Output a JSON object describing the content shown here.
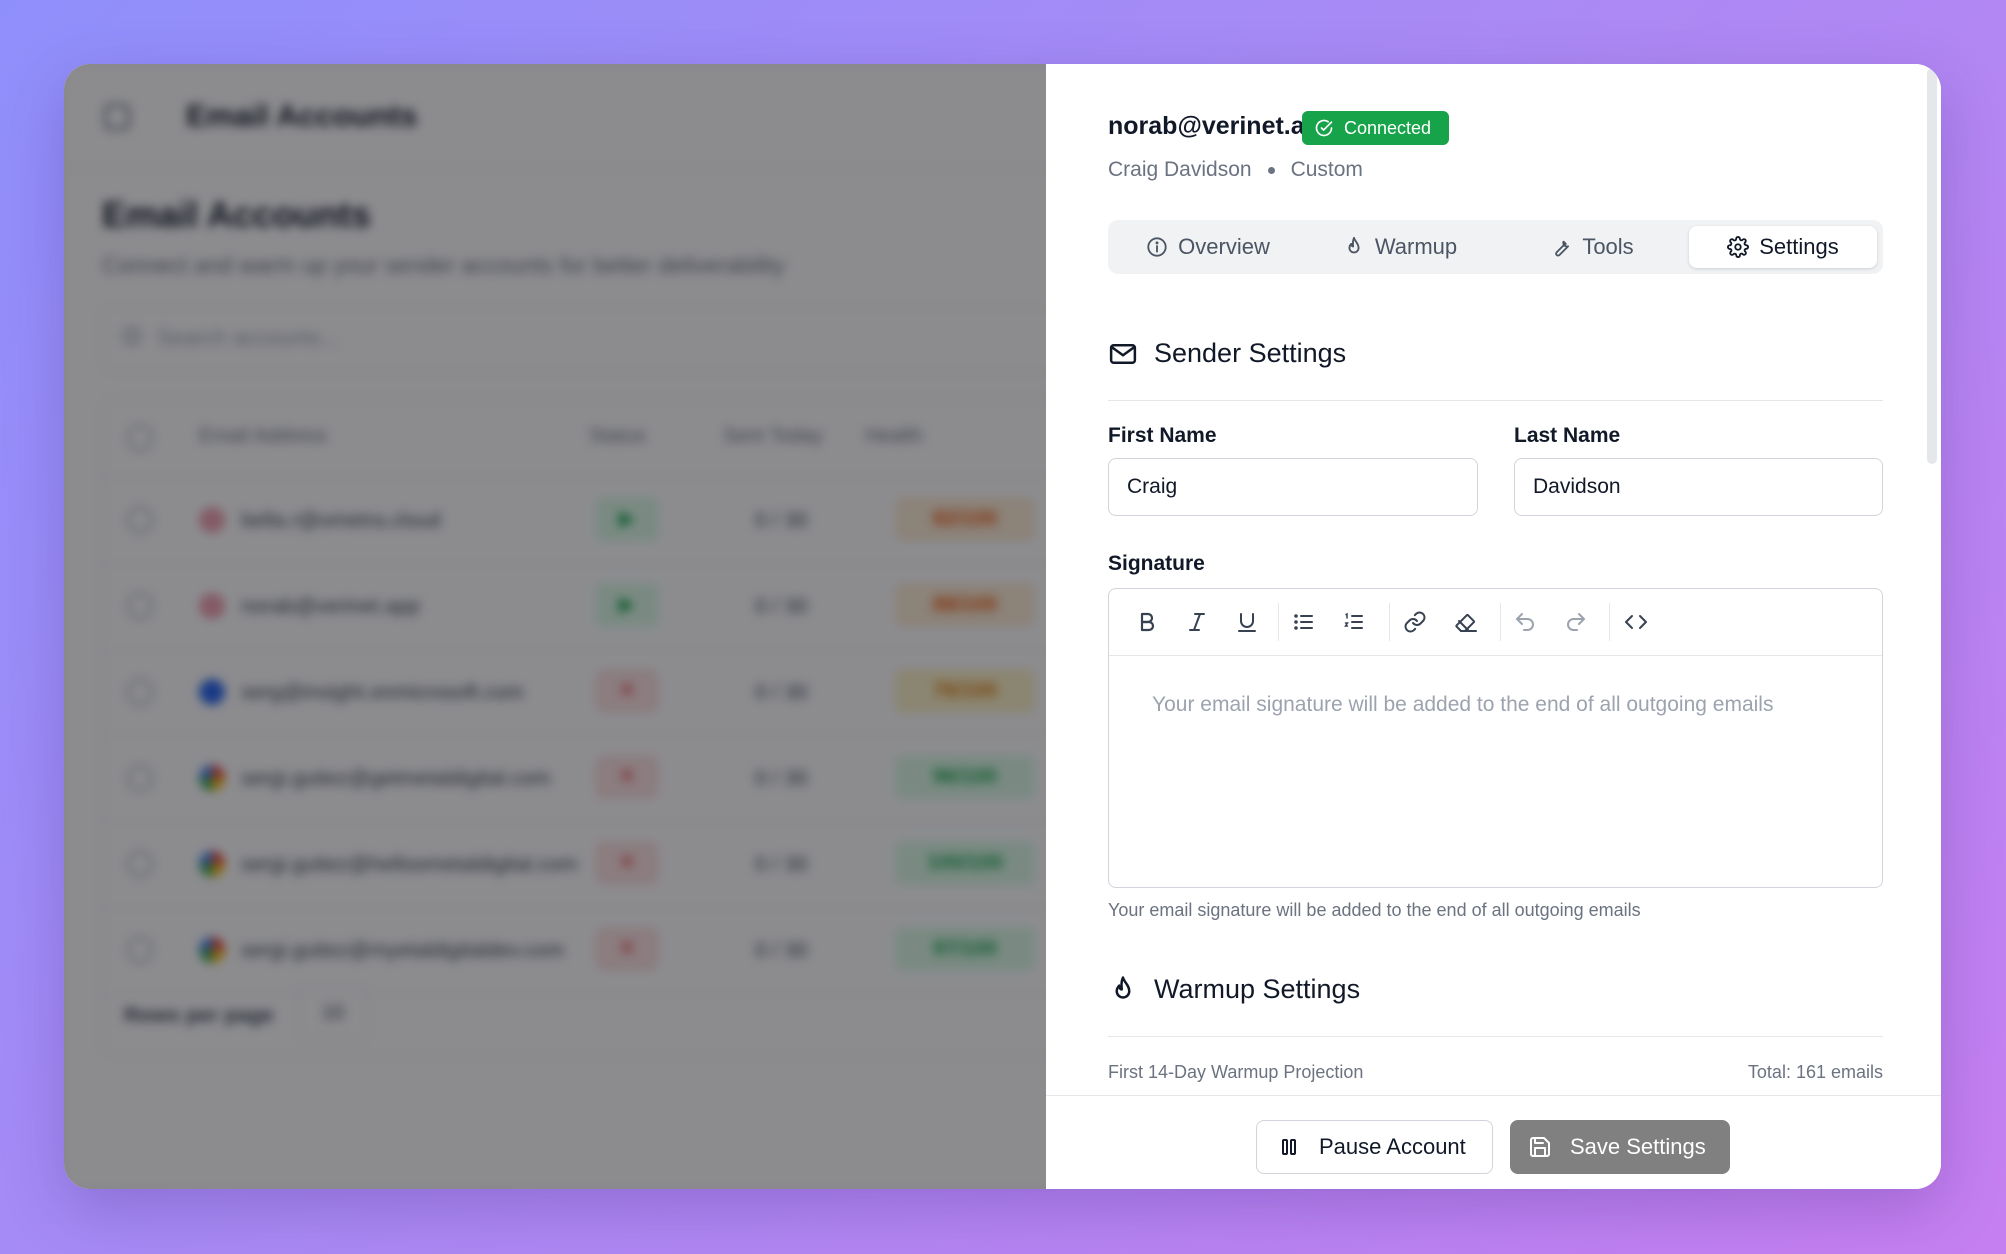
{
  "background_app": {
    "top_title": "Email Accounts",
    "page_title": "Email Accounts",
    "page_subtitle": "Connect and warm up your sender accounts for better deliverability",
    "search_placeholder": "Search accounts...",
    "columns": [
      "Email Address",
      "Status",
      "Sent Today",
      "Health"
    ],
    "rows": [
      {
        "email": "bella.r@ometra.cloud",
        "status": "▶",
        "sent": "0 / 30",
        "health": "82/100"
      },
      {
        "email": "norab@verinet.app",
        "status": "▶",
        "sent": "0 / 30",
        "health": "88/100"
      },
      {
        "email": "serg@insight.onmicrosoft.com",
        "status": "✕",
        "sent": "0 / 30",
        "health": "76/100"
      },
      {
        "email": "sergi.gutiez@getmetaldigital.com",
        "status": "✕",
        "sent": "0 / 30",
        "health": "96/100"
      },
      {
        "email": "sergi.gutiez@helloometaldigital.com",
        "status": "✕",
        "sent": "0 / 30",
        "health": "100/100"
      },
      {
        "email": "sergi.gutiez@myetaldigitaldev.com",
        "status": "✕",
        "sent": "0 / 30",
        "health": "97/100"
      }
    ],
    "rows_per_page_label": "Rows per page",
    "rows_per_page_value": "10"
  },
  "drawer": {
    "email": "norab@verinet.app",
    "badge": "Connected",
    "owner": "Craig Davidson",
    "type": "Custom",
    "tabs": [
      {
        "label": "Overview",
        "icon": "info-icon"
      },
      {
        "label": "Warmup",
        "icon": "flame-icon"
      },
      {
        "label": "Tools",
        "icon": "wrench-icon"
      },
      {
        "label": "Settings",
        "icon": "gear-icon"
      }
    ],
    "active_tab": "Settings",
    "sender_settings": {
      "title": "Sender Settings",
      "first_name_label": "First Name",
      "first_name_value": "Craig",
      "last_name_label": "Last Name",
      "last_name_value": "Davidson",
      "signature_label": "Signature",
      "signature_placeholder": "Your email signature will be added to the end of all outgoing emails",
      "signature_helper": "Your email signature will be added to the end of all outgoing emails"
    },
    "warmup_settings": {
      "title": "Warmup Settings",
      "projection_label": "First 14-Day Warmup Projection",
      "projection_total": "Total: 161 emails"
    },
    "footer": {
      "pause_label": "Pause Account",
      "save_label": "Save Settings"
    }
  },
  "colors": {
    "badge_green": "#16a34a",
    "primary_button": "#808080"
  }
}
